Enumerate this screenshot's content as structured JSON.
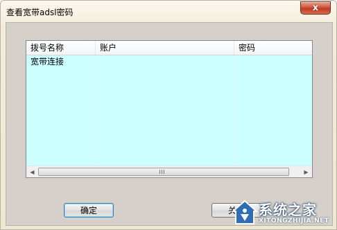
{
  "window": {
    "title": "查看宽带adsl密码",
    "close_glyph": "x"
  },
  "listview": {
    "columns": [
      "拨号名称",
      "账户",
      "密码"
    ],
    "rows": [
      [
        "宽带连接",
        "",
        ""
      ]
    ],
    "background": "#ccffff"
  },
  "scrollbar": {
    "left_arrow": "◀",
    "right_arrow": "▶"
  },
  "buttons": {
    "ok_label": "确定",
    "close_label": "关闭"
  },
  "watermark": {
    "text": "系统之家",
    "subtext": "XITONGZHIJIA.NET"
  }
}
